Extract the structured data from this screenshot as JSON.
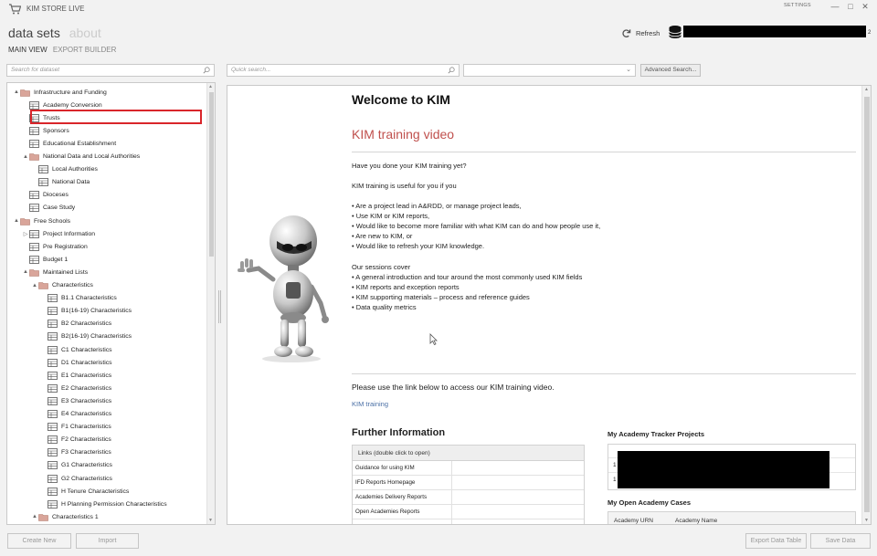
{
  "window": {
    "title": "KIM STORE LIVE",
    "settings_label": "SETTINGS",
    "min": "—",
    "max": "□",
    "close": "✕"
  },
  "nav": {
    "main_tabs": [
      {
        "label": "data sets",
        "active": true
      },
      {
        "label": "about",
        "active": false
      }
    ],
    "sub_tabs": [
      {
        "label": "MAIN VIEW",
        "active": true
      },
      {
        "label": "EXPORT BUILDER",
        "active": false
      }
    ],
    "refresh_label": "Refresh",
    "user_suffix": "2"
  },
  "search": {
    "dataset_placeholder": "Search for dataset",
    "quick_placeholder": "Quick search...",
    "filter_value": "",
    "advanced_label": "Advanced Search..."
  },
  "tree": [
    {
      "label": "Infrastructure and Funding",
      "level": 0,
      "type": "folder",
      "toggle": "▲"
    },
    {
      "label": "Academy Conversion",
      "level": 1,
      "type": "table"
    },
    {
      "label": "Trusts",
      "level": 1,
      "type": "table"
    },
    {
      "label": "Sponsors",
      "level": 1,
      "type": "table"
    },
    {
      "label": "Educational Establishment",
      "level": 1,
      "type": "table"
    },
    {
      "label": "National Data and Local Authorities",
      "level": 1,
      "type": "folder",
      "toggle": "▲"
    },
    {
      "label": "Local Authorities",
      "level": 2,
      "type": "table"
    },
    {
      "label": "National Data",
      "level": 2,
      "type": "table"
    },
    {
      "label": "Dioceses",
      "level": 1,
      "type": "table"
    },
    {
      "label": "Case Study",
      "level": 1,
      "type": "table"
    },
    {
      "label": "Free Schools",
      "level": 0,
      "type": "folder",
      "toggle": "▲"
    },
    {
      "label": "Project Information",
      "level": 1,
      "type": "table",
      "toggle": "▷"
    },
    {
      "label": "Pre Registration",
      "level": 1,
      "type": "table"
    },
    {
      "label": "Budget 1",
      "level": 1,
      "type": "table"
    },
    {
      "label": "Maintained Lists",
      "level": 1,
      "type": "folder",
      "toggle": "▲"
    },
    {
      "label": "Characteristics",
      "level": 2,
      "type": "folder",
      "toggle": "▲"
    },
    {
      "label": "B1.1 Characteristics",
      "level": 3,
      "type": "table"
    },
    {
      "label": "B1(16-19) Characteristics",
      "level": 3,
      "type": "table"
    },
    {
      "label": "B2 Characteristics",
      "level": 3,
      "type": "table"
    },
    {
      "label": "B2(16-19) Characteristics",
      "level": 3,
      "type": "table"
    },
    {
      "label": "C1 Characteristics",
      "level": 3,
      "type": "table"
    },
    {
      "label": "D1 Characteristics",
      "level": 3,
      "type": "table"
    },
    {
      "label": "E1 Characteristics",
      "level": 3,
      "type": "table"
    },
    {
      "label": "E2 Characteristics",
      "level": 3,
      "type": "table"
    },
    {
      "label": "E3 Characteristics",
      "level": 3,
      "type": "table"
    },
    {
      "label": "E4 Characteristics",
      "level": 3,
      "type": "table"
    },
    {
      "label": "F1 Characteristics",
      "level": 3,
      "type": "table"
    },
    {
      "label": "F2 Characteristics",
      "level": 3,
      "type": "table"
    },
    {
      "label": "F3 Characteristics",
      "level": 3,
      "type": "table"
    },
    {
      "label": "G1 Characteristics",
      "level": 3,
      "type": "table"
    },
    {
      "label": "G2 Characteristics",
      "level": 3,
      "type": "table"
    },
    {
      "label": "H Tenure Characteristics",
      "level": 3,
      "type": "table"
    },
    {
      "label": "H Planning Permission Characteristics",
      "level": 3,
      "type": "table"
    },
    {
      "label": "Characteristics 1",
      "level": 2,
      "type": "folder",
      "toggle": "▲"
    }
  ],
  "content": {
    "welcome": "Welcome to KIM",
    "training_title": "KIM training video",
    "question": "Have you done your KIM training yet?",
    "useful_intro": "KIM training is useful for you if you",
    "useful_bullets": [
      "• Are a project lead in A&RDD, or manage project leads,",
      "• Use KIM or KIM reports,",
      "• Would like to become more familiar with what KIM can do and how people use it,",
      "• Are new to KIM, or",
      "• Would like to refresh your KIM knowledge."
    ],
    "sessions_intro": "Our sessions cover",
    "sessions_bullets": [
      "• A general introduction and tour around the most commonly used KIM fields",
      "• KIM reports and exception reports",
      "• KIM supporting materials –  process and reference guides",
      "• Data quality metrics"
    ],
    "link_intro": "Please use the link below to access our KIM training video.",
    "training_link": "KIM training",
    "further_title": "Further Information",
    "links_header": "Links (double click to open)",
    "links": [
      "Guidance for using KIM",
      "IFD Reports Homepage",
      "Academies Delivery Reports",
      "Open Academies Reports",
      ""
    ],
    "tracker_title": "My Academy Tracker Projects",
    "tracker_rows": [
      "1",
      "1"
    ],
    "cases_title": "My Open Academy Cases",
    "cases_columns": [
      "Academy URN",
      "Academy Name"
    ]
  },
  "footer": {
    "create_new": "Create New",
    "import": "Import",
    "export_data_table": "Export Data Table",
    "save_data": "Save Data"
  },
  "colors": {
    "accent_title": "#c0504d",
    "link": "#4a6fa5",
    "highlight_box": "#d9252a",
    "folder_icon": "#d9a59a"
  }
}
